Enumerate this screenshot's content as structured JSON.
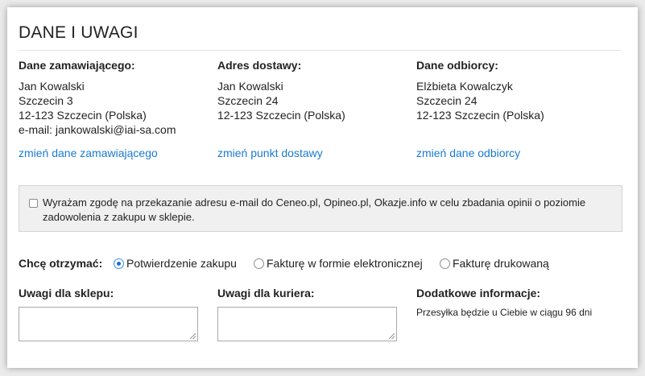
{
  "section": {
    "title": "DANE I UWAGI"
  },
  "orderer": {
    "heading": "Dane zamawiającego:",
    "lines": [
      "Jan Kowalski",
      "Szczecin 3",
      "12-123 Szczecin (Polska)",
      "e-mail: jankowalski@iai-sa.com"
    ],
    "link": "zmień dane zamawiającego"
  },
  "delivery": {
    "heading": "Adres dostawy:",
    "lines": [
      "Jan Kowalski",
      "Szczecin 24",
      "12-123 Szczecin (Polska)"
    ],
    "link": "zmień punkt dostawy"
  },
  "recipient": {
    "heading": "Dane odbiorcy:",
    "lines": [
      "Elżbieta Kowalczyk",
      "Szczecin 24",
      "12-123 Szczecin (Polska)"
    ],
    "link": "zmień dane odbiorcy"
  },
  "consent": {
    "checked": false,
    "text": "Wyrażam zgodę na przekazanie adresu e-mail do Ceneo.pl, Opineo.pl, Okazje.info w celu zbadania opinii o poziomie zadowolenia z zakupu w sklepie."
  },
  "receive": {
    "label": "Chcę otrzymać:",
    "options": [
      {
        "label": "Potwierdzenie zakupu",
        "selected": true
      },
      {
        "label": "Fakturę w formie elektronicznej",
        "selected": false
      },
      {
        "label": "Fakturę drukowaną",
        "selected": false
      }
    ]
  },
  "notes": {
    "shop_label": "Uwagi dla sklepu:",
    "shop_value": "",
    "courier_label": "Uwagi dla kuriera:",
    "courier_value": "",
    "extra_label": "Dodatkowe informacje:",
    "extra_text": "Przesyłka będzie u Ciebie w ciągu 96 dni"
  },
  "colors": {
    "link": "#1a7bd0",
    "radio_selected": "#1f6fd8",
    "consent_bg": "#f0f0f0"
  }
}
